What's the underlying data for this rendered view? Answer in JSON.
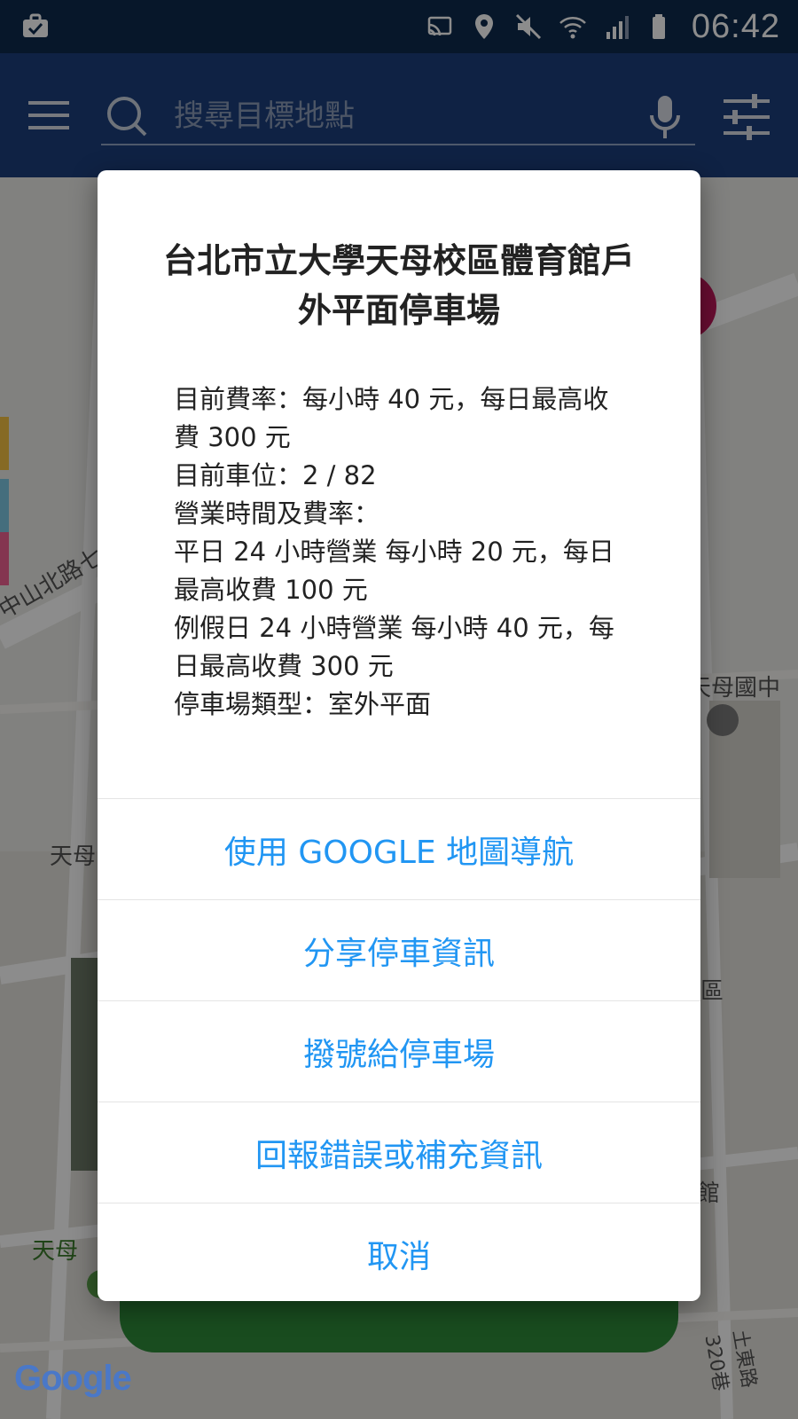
{
  "status_bar": {
    "time": "06:42",
    "icons": [
      "briefcase-check-icon",
      "cast-icon",
      "location-icon",
      "mute-icon",
      "wifi-icon",
      "signal-icon",
      "battery-icon"
    ]
  },
  "app_bar": {
    "search_placeholder": "搜尋目標地點",
    "icons": [
      "menu-icon",
      "search-icon",
      "mic-icon",
      "filter-icon"
    ]
  },
  "map": {
    "labels": {
      "street_1": "中山北路七段",
      "school": "天母國中",
      "area_1": "天母",
      "area_2": "區",
      "area_3": "天母",
      "building": "館",
      "road_2": "土東路320巷"
    }
  },
  "dialog": {
    "title": "台北市立大學天母校區體育館戶外平面停車場",
    "body_lines": [
      "目前費率：每小時 40 元，每日最高收費 300 元",
      "目前車位：2 / 82",
      "營業時間及費率：",
      "平日 24 小時營業 每小時 20 元，每日最高收費 100 元",
      "例假日 24 小時營業 每小時 40 元，每日最高收費 300 元",
      "停車場類型：室外平面"
    ],
    "actions": {
      "navigate": "使用 GOOGLE 地圖導航",
      "share": "分享停車資訊",
      "call": "撥號給停車場",
      "report": "回報錯誤或補充資訊",
      "cancel": "取消"
    }
  },
  "colors": {
    "status_bar": "#0d2a4e",
    "app_bar": "#1c3f7c",
    "action_text": "#2196f3",
    "green_bar": "#2e8b3a"
  },
  "map_attribution": "Google"
}
